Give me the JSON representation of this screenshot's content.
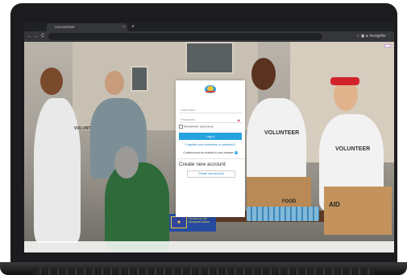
{
  "browser": {
    "tab_title": "VOLUNTEER",
    "tab_close": "×",
    "new_tab": "+",
    "url": "",
    "incognito_label": "Incognito",
    "nav_back": "←",
    "nav_forward": "→",
    "nav_reload": "C"
  },
  "page": {
    "language_button": "",
    "login": {
      "username_placeholder": "Username",
      "password_placeholder": "Password",
      "remember_label": "Remember username",
      "login_button": "Log in",
      "forgot_link": "Forgotten your username or password?",
      "cookie_notice": "Cookies must be enabled in your browser",
      "create_title": "Create new account",
      "create_button": "Create new account"
    },
    "eu_text": "Funded by the European Union",
    "footer_line1": "",
    "footer_line2": ""
  },
  "photo": {
    "shirt_labels": [
      "VOLUNTEER",
      "VOLUNTEER",
      "VOLUNTEER"
    ],
    "box_labels": [
      "FOOD",
      "AID"
    ]
  },
  "colors": {
    "accent": "#26a3df",
    "eu_blue": "#1e48a8",
    "eu_yellow": "#f3d33a"
  }
}
